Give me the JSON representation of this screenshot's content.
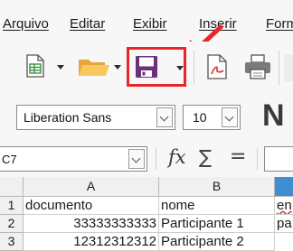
{
  "menubar": {
    "items": [
      "Arquivo",
      "Editar",
      "Exibir",
      "Inserir",
      "Form"
    ]
  },
  "toolbar": {
    "icons": [
      "new-spreadsheet-icon",
      "open-folder-icon",
      "save-icon",
      "export-pdf-icon",
      "print-icon"
    ],
    "annotation_color": "#e8262a"
  },
  "formatting": {
    "font_name": "Liberation Sans",
    "font_size": "10",
    "bold_glyph": "N"
  },
  "formula_bar": {
    "name_box": "C7",
    "function_wizard": "fx",
    "sum": "∑",
    "equals": "="
  },
  "sheet": {
    "columns": [
      "A",
      "B"
    ],
    "rows": [
      {
        "num": "1",
        "a": "documento",
        "b": "nome",
        "c": "en"
      },
      {
        "num": "2",
        "a": "33333333333",
        "b": "Participante 1",
        "c": "pa"
      },
      {
        "num": "3",
        "a": "12312312312",
        "b": "Participante 2",
        "c": ""
      }
    ]
  }
}
